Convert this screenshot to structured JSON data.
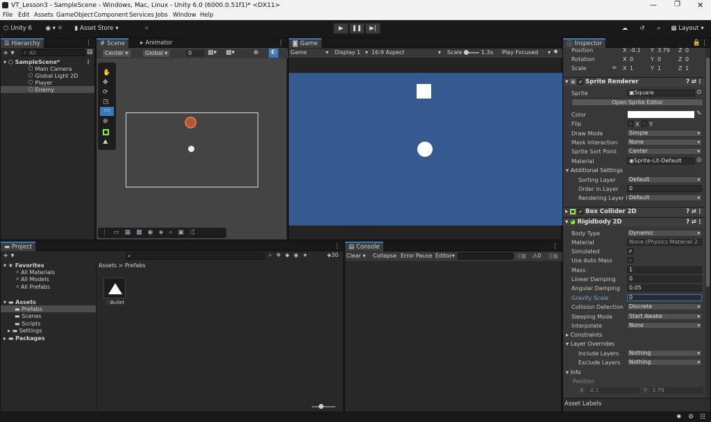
{
  "window": {
    "title": "VT_Lesson3 - SampleScene - Windows, Mac, Linux - Unity 6.0 (6000.0.51f1)* <DX11>"
  },
  "menu": [
    "File",
    "Edit",
    "Assets",
    "GameObject",
    "Component",
    "Services",
    "Jobs",
    "Window",
    "Help"
  ],
  "toolbar": {
    "unity": "Unity 6",
    "asset_store": "Asset Store",
    "layout": "Layout"
  },
  "hierarchy": {
    "tab": "Hierarchy",
    "search": "All",
    "scene": "SampleScene*",
    "items": [
      "Main Camera",
      "Global Light 2D",
      "Player",
      "Enemy"
    ]
  },
  "scene": {
    "tab": "Scene",
    "animator_tab": "Animator",
    "pivot": "Center",
    "space": "Global",
    "snap": "0"
  },
  "game": {
    "tab": "Game",
    "mode": "Game",
    "display": "Display 1",
    "aspect": "16:9 Aspect",
    "scale_label": "Scale",
    "scale": "1.3x",
    "play_mode": "Play Focused",
    "bg": "#355a91"
  },
  "inspector": {
    "tab": "Inspector",
    "transform": {
      "position_label": "Position",
      "px": "-0.1",
      "py": "3.79",
      "pz": "0",
      "rotation_label": "Rotation",
      "rx": "0",
      "ry": "0",
      "rz": "0",
      "scale_label": "Scale",
      "sx": "1",
      "sy": "1",
      "sz": "1"
    },
    "sprite_renderer": {
      "title": "Sprite Renderer",
      "sprite_label": "Sprite",
      "sprite": "Square",
      "open_editor": "Open Sprite Editor",
      "color_label": "Color",
      "flip_label": "Flip",
      "flip_x": "X",
      "flip_y": "Y",
      "draw_mode_label": "Draw Mode",
      "draw_mode": "Simple",
      "mask_label": "Mask Interaction",
      "mask": "None",
      "sort_point_label": "Sprite Sort Point",
      "sort_point": "Center",
      "material_label": "Material",
      "material": "Sprite-Lit-Default",
      "additional": "Additional Settings",
      "sorting_layer_label": "Sorting Layer",
      "sorting_layer": "Default",
      "order_label": "Order in Layer",
      "order": "0",
      "rendering_layer_label": "Rendering Layer M",
      "rendering_layer": "Default"
    },
    "box_collider": {
      "title": "Box Collider 2D"
    },
    "rigidbody": {
      "title": "Rigidbody 2D",
      "body_type_label": "Body Type",
      "body_type": "Dynamic",
      "material_label": "Material",
      "material": "None (Physics Material 2",
      "simulated_label": "Simulated",
      "auto_mass_label": "Use Auto Mass",
      "mass_label": "Mass",
      "mass": "1",
      "linear_label": "Linear Damping",
      "linear": "0",
      "angular_label": "Angular Damping",
      "angular": "0.05",
      "gravity_label": "Gravity Scale",
      "gravity": "0",
      "collision_label": "Collision Detection",
      "collision": "Discrete",
      "sleeping_label": "Sleeping Mode",
      "sleeping": "Start Awake",
      "interpolate_label": "Interpolate",
      "interpolate": "None",
      "constraints": "Constraints",
      "layer_overrides": "Layer Overrides",
      "include_label": "Include Layers",
      "include": "Nothing",
      "exclude_label": "Exclude Layers",
      "exclude": "Nothing",
      "info": "Info",
      "info_position": "Position",
      "info_x": "-0.1",
      "info_y": "3.79",
      "x": "X",
      "y": "Y"
    },
    "asset_labels": "Asset Labels"
  },
  "project": {
    "tab": "Project",
    "favorites": "Favorites",
    "fav_items": [
      "All Materials",
      "All Models",
      "All Prefabs"
    ],
    "assets": "Assets",
    "asset_items": [
      "Prefabs",
      "Scenes",
      "Scripts",
      "Settings"
    ],
    "packages": "Packages",
    "breadcrumb_root": "Assets",
    "breadcrumb_sep": ">",
    "breadcrumb_leaf": "Prefabs",
    "asset_name": "Bullet",
    "count": "30"
  },
  "console": {
    "tab": "Console",
    "clear": "Clear",
    "collapse": "Collapse",
    "error_pause": "Error Pause",
    "editor": "Editor",
    "logs": "0",
    "warnings": "0",
    "errors": "0"
  }
}
